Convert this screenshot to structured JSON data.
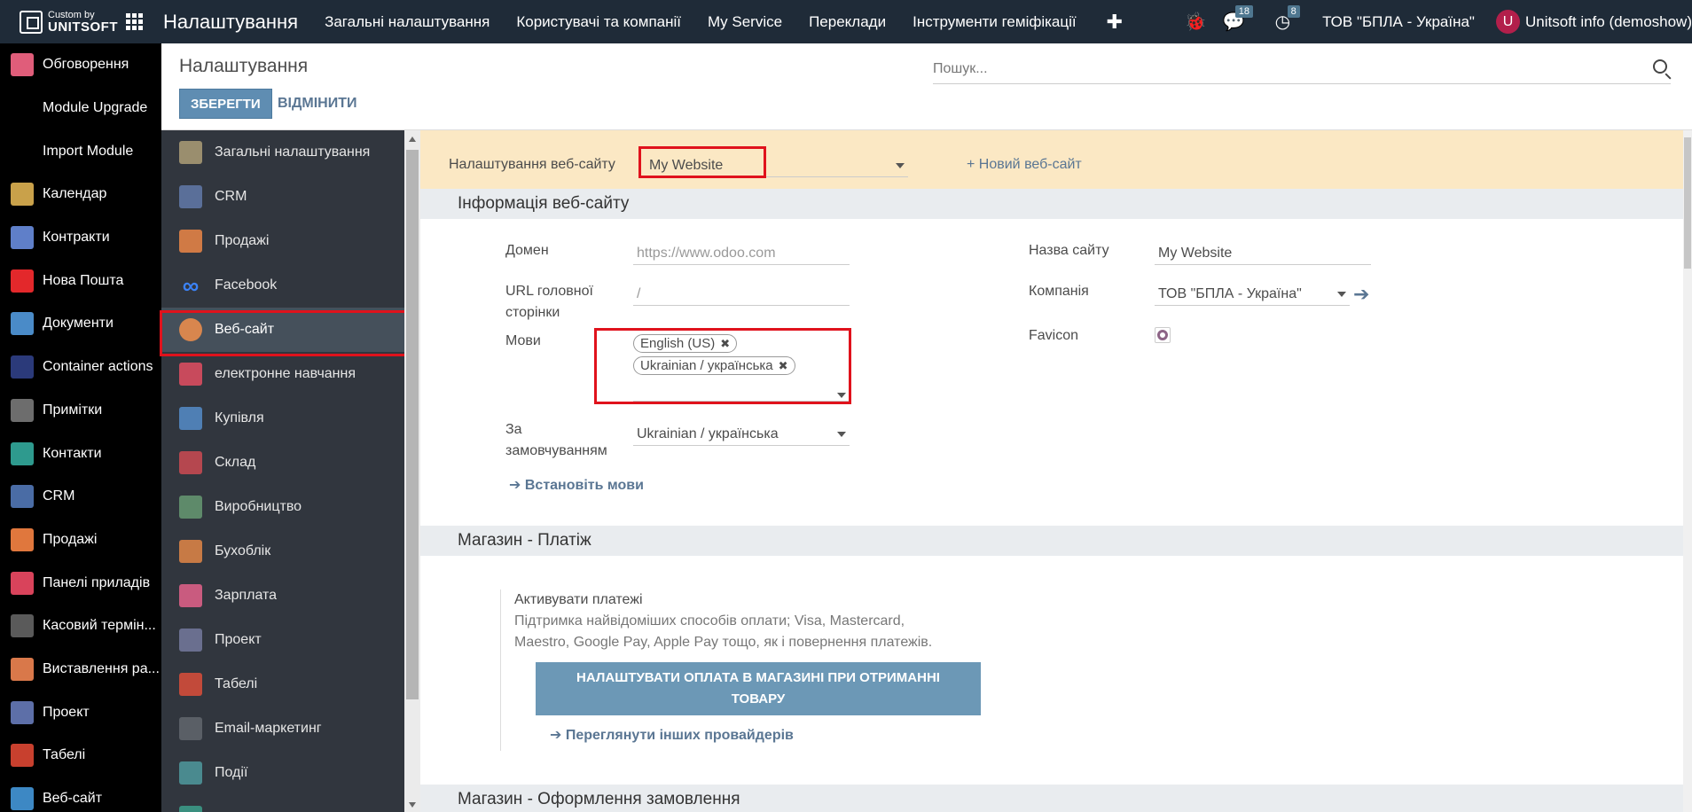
{
  "topbar": {
    "brand_small": "Custom by",
    "brand_big": "UNITSOFT",
    "app_title": "Налаштування",
    "menu": [
      "Загальні налаштування",
      "Користувачі та компанії",
      "My Service",
      "Переклади",
      "Інструменти геміфікації"
    ],
    "plus": "✚",
    "bug_icon": "🐞",
    "chat_icon": "💬",
    "chat_count": "18",
    "activity_icon": "◷",
    "activity_count": "8",
    "company": "ТОВ \"БПЛА - Україна\"",
    "avatar_letter": "U",
    "user": "Unitsoft info (demoshow)"
  },
  "appbar": {
    "items": [
      {
        "label": "Обговорення",
        "color": "#e05d7a"
      },
      {
        "label": "Module Upgrade",
        "color": ""
      },
      {
        "label": "Import Module",
        "color": ""
      },
      {
        "label": "Календар",
        "color": "#c9a14a"
      },
      {
        "label": "Контракти",
        "color": "#5f7fc9"
      },
      {
        "label": "Нова Пошта",
        "color": "#e3282b"
      },
      {
        "label": "Документи",
        "color": "#4a8bc8"
      },
      {
        "label": "Container actions",
        "color": "#2b3a7a"
      },
      {
        "label": "Примітки",
        "color": "#6d6d6d"
      },
      {
        "label": "Контакти",
        "color": "#2e9a8e"
      },
      {
        "label": "CRM",
        "color": "#4a6ca5"
      },
      {
        "label": "Продажі",
        "color": "#e0773d"
      },
      {
        "label": "Панелі приладів",
        "color": "#d9435b"
      },
      {
        "label": "Касовий термін...",
        "color": "#5a5a5a"
      },
      {
        "label": "Виставлення ра...",
        "color": "#d9784a"
      },
      {
        "label": "Проект",
        "color": "#5d6fa8"
      },
      {
        "label": "Табелі",
        "color": "#c8402e"
      },
      {
        "label": "Веб-сайт",
        "color": "#3d88c4"
      }
    ]
  },
  "control_panel": {
    "title": "Налаштування",
    "save_label": "ЗБЕРЕГТИ",
    "cancel_label": "ВІДМІНИТИ",
    "search_placeholder": "Пошук..."
  },
  "settings_nav": {
    "items": [
      {
        "label": "Загальні налаштування",
        "color": "#9a8e6e"
      },
      {
        "label": "CRM",
        "color": "#5a6f99"
      },
      {
        "label": "Продажі",
        "color": "#d07a45"
      },
      {
        "label": "Facebook",
        "color": ""
      },
      {
        "label": "Веб-сайт",
        "color": "#d8864e"
      },
      {
        "label": "електронне навчання",
        "color": "#c84a5c"
      },
      {
        "label": "Купівля",
        "color": "#4f7fb4"
      },
      {
        "label": "Склад",
        "color": "#b5474f"
      },
      {
        "label": "Виробництво",
        "color": "#5e8a6a"
      },
      {
        "label": "Бухоблік",
        "color": "#c77a45"
      },
      {
        "label": "Зарплата",
        "color": "#c95b7f"
      },
      {
        "label": "Проект",
        "color": "#6a6f8f"
      },
      {
        "label": "Табелі",
        "color": "#c24a3a"
      },
      {
        "label": "Email-маркетинг",
        "color": "#5a5f66"
      },
      {
        "label": "Події",
        "color": "#4a8a8f"
      },
      {
        "label": "",
        "color": "#3a8f7f"
      }
    ],
    "facebook_glyph": "∞"
  },
  "website": {
    "label": "Налаштування веб-сайту",
    "selected": "My Website",
    "new_site": "+ Новий веб-сайт"
  },
  "info": {
    "title": "Інформація веб-сайту",
    "domain_label": "Домен",
    "domain_placeholder": "https://www.odoo.com",
    "homepage_label_1": "URL головної",
    "homepage_label_2": "сторінки",
    "homepage_placeholder": "/",
    "languages_label": "Мови",
    "languages": [
      "English (US)",
      "Ukrainian / українська"
    ],
    "default_label_1": "За",
    "default_label_2": "замовчуванням",
    "default_value": "Ukrainian / українська",
    "install_langs": "Встановіть мови",
    "site_name_label": "Назва сайту",
    "site_name": "My Website",
    "company_label": "Компанія",
    "company": "ТОВ \"БПЛА - Україна\"",
    "favicon_label": "Favicon"
  },
  "payment": {
    "title": "Магазин - Платіж",
    "activate": "Активувати платежі",
    "desc_1": "Підтримка найвідоміших способів оплати; Visa, Mastercard,",
    "desc_2": "Maestro, Google Pay, Apple Pay тощо, як і повернення платежів.",
    "button_1": "НАЛАШТУВАТИ ОПЛАТА В МАГАЗИНІ ПРИ ОТРИМАННІ",
    "button_2": "ТОВАРУ",
    "providers": "Переглянути інших провайдерів"
  },
  "checkout": {
    "title": "Магазин - Оформлення замовлення"
  }
}
